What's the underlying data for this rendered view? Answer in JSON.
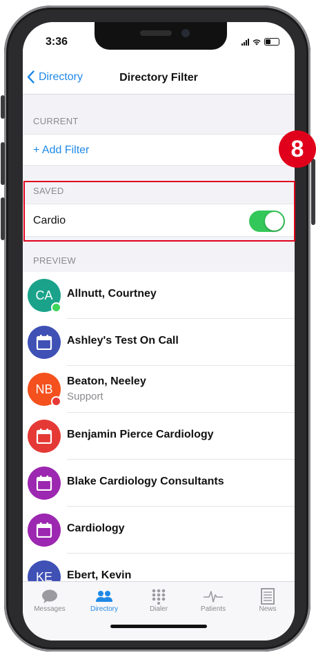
{
  "status_bar": {
    "time": "3:36"
  },
  "nav": {
    "back_label": "Directory",
    "title": "Directory Filter"
  },
  "sections": {
    "current": "CURRENT",
    "saved": "SAVED",
    "preview": "PREVIEW"
  },
  "current": {
    "add_filter": "+ Add Filter"
  },
  "saved": {
    "filter_name": "Cardio",
    "toggle_on": true,
    "toggle_color": "#34c759"
  },
  "preview_items": [
    {
      "initials": "CA",
      "name": "Allnutt, Courtney",
      "subtitle": "",
      "avatar_color": "#1aa38a",
      "icon": "",
      "status_color": "#3dd65a"
    },
    {
      "initials": "",
      "name": "Ashley's Test On Call",
      "subtitle": "",
      "avatar_color": "#3f51b5",
      "icon": "calendar-icon",
      "status_color": ""
    },
    {
      "initials": "NB",
      "name": "Beaton, Neeley",
      "subtitle": "Support",
      "avatar_color": "#f4511e",
      "icon": "",
      "status_color": "#e53935"
    },
    {
      "initials": "",
      "name": "Benjamin Pierce Cardiology",
      "subtitle": "",
      "avatar_color": "#e53935",
      "icon": "calendar-icon",
      "status_color": ""
    },
    {
      "initials": "",
      "name": "Blake Cardiology Consultants",
      "subtitle": "",
      "avatar_color": "#9c27b0",
      "icon": "calendar-icon",
      "status_color": ""
    },
    {
      "initials": "",
      "name": "Cardiology",
      "subtitle": "",
      "avatar_color": "#9c27b0",
      "icon": "calendar-icon",
      "status_color": ""
    },
    {
      "initials": "KE",
      "name": "Ebert, Kevin",
      "subtitle": "",
      "avatar_color": "#3f51b5",
      "icon": "",
      "status_color": ""
    }
  ],
  "tabs": [
    {
      "label": "Messages",
      "icon": "chat-bubble-icon"
    },
    {
      "label": "Directory",
      "icon": "people-icon",
      "active": true
    },
    {
      "label": "Dialer",
      "icon": "dialpad-icon"
    },
    {
      "label": "Patients",
      "icon": "heartbeat-icon"
    },
    {
      "label": "News",
      "icon": "newspaper-icon"
    }
  ],
  "annotation": {
    "badge_number": "8",
    "highlight_color": "#e0001b"
  },
  "colors": {
    "accent": "#1e88e5"
  }
}
